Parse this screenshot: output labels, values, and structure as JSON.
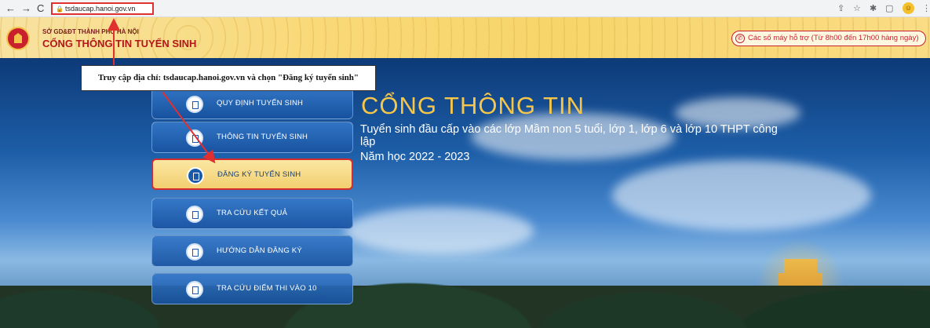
{
  "browser": {
    "back": "←",
    "forward": "→",
    "reload": "C",
    "url": "tsdaucap.hanoi.gov.vn"
  },
  "header": {
    "org_name": "SỞ GD&ĐT THÀNH PHỐ HÀ NỘI",
    "portal_name": "CỔNG THÔNG TIN TUYỂN SINH",
    "hotline": "Các số máy hỗ trợ (Từ 8h00 đến 17h00 hàng ngày)"
  },
  "menu": {
    "items": [
      {
        "label": "QUY ĐỊNH TUYỂN SINH"
      },
      {
        "label": "THÔNG TIN TUYỂN SINH"
      },
      {
        "label": "ĐĂNG KÝ TUYỂN SINH"
      },
      {
        "label": "TRA CỨU KẾT QUẢ"
      },
      {
        "label": "HƯỚNG DẪN ĐĂNG KÝ"
      },
      {
        "label": "TRA CỨU ĐIỂM THI VÀO 10"
      }
    ]
  },
  "hero": {
    "title": "CỔNG THÔNG TIN",
    "subtitle": "Tuyển sinh đầu cấp vào các lớp Mầm non 5 tuổi, lớp 1, lớp 6 và lớp 10 THPT công lập",
    "year": "Năm học 2022 - 2023"
  },
  "annotation": {
    "text": "Truy cập địa chỉ: tsdaucap.hanoi.gov.vn và chọn \"Đăng ký tuyển sinh\"",
    "color": "#e03030"
  }
}
